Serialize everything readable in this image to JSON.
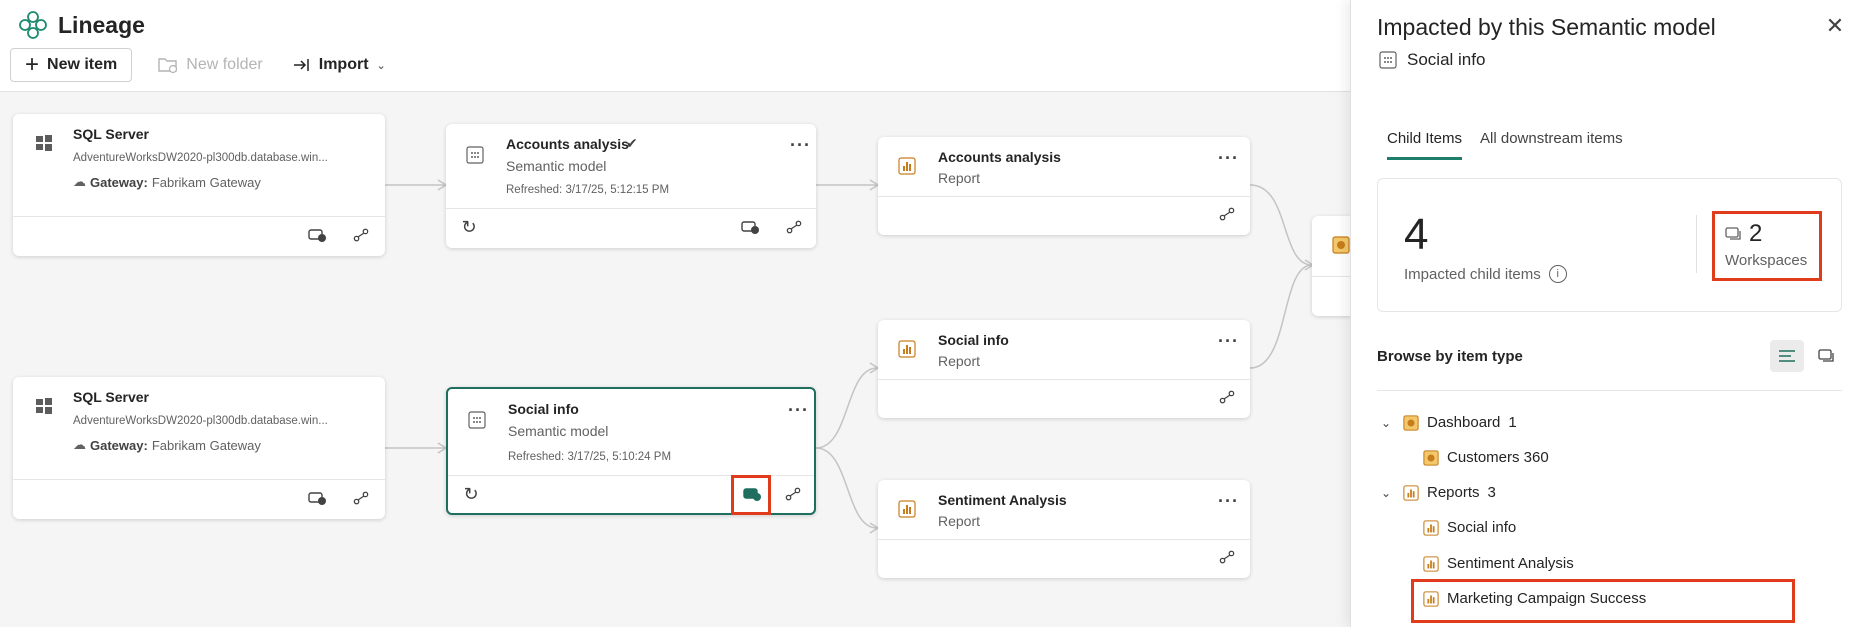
{
  "header": {
    "title": "Lineage",
    "new_item": "New item",
    "new_folder": "New folder",
    "import": "Import"
  },
  "nodes": {
    "sql1": {
      "title": "SQL Server",
      "server": "AdventureWorksDW2020-pl300db.database.win...",
      "gateway_label": "Gateway:",
      "gateway_value": "Fabrikam Gateway"
    },
    "sql2": {
      "title": "SQL Server",
      "server": "AdventureWorksDW2020-pl300db.database.win...",
      "gateway_label": "Gateway:",
      "gateway_value": "Fabrikam Gateway"
    },
    "sm_accounts": {
      "title": "Accounts analysis",
      "type": "Semantic model",
      "refreshed": "Refreshed: 3/17/25, 5:12:15 PM"
    },
    "sm_social": {
      "title": "Social info",
      "type": "Semantic model",
      "refreshed": "Refreshed: 3/17/25, 5:10:24 PM"
    },
    "rep_accounts": {
      "title": "Accounts analysis",
      "type": "Report"
    },
    "rep_social": {
      "title": "Social info",
      "type": "Report"
    },
    "rep_sentiment": {
      "title": "Sentiment Analysis",
      "type": "Report"
    }
  },
  "panel": {
    "title": "Impacted by this Semantic model",
    "subject": "Social info",
    "tabs": [
      "Child Items",
      "All downstream items"
    ],
    "impacted_count": "4",
    "impacted_label": "Impacted child items",
    "workspaces_count": "2",
    "workspaces_label": "Workspaces",
    "browse_label": "Browse by item type",
    "tree": {
      "dashboard_group": "Dashboard",
      "dashboard_count": "1",
      "dashboard_items": [
        "Customers 360"
      ],
      "reports_group": "Reports",
      "reports_count": "3",
      "report_items": [
        "Social info",
        "Sentiment Analysis",
        "Marketing Campaign Success"
      ]
    }
  },
  "colors": {
    "accent": "#1f6e5f",
    "highlight": "#e03c1c",
    "report_icon": "#c77d1c"
  }
}
